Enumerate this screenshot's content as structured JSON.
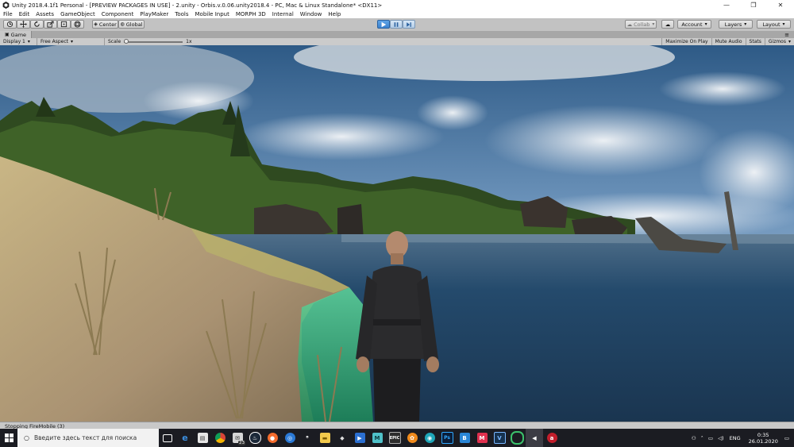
{
  "window": {
    "title": "Unity 2018.4.1f1 Personal - [PREVIEW PACKAGES IN USE] - 2.unity - Orbis.v.0.06.unity2018.4 - PC, Mac & Linux Standalone* <DX11>",
    "minimize": "—",
    "maximize": "❐",
    "close": "✕"
  },
  "menu": [
    "File",
    "Edit",
    "Assets",
    "GameObject",
    "Component",
    "PlayMaker",
    "Tools",
    "Mobile Input",
    "MORPH 3D",
    "Internal",
    "Window",
    "Help"
  ],
  "toolbar": {
    "pivot_label": "Center",
    "space_label": "Global",
    "collab_label": "Collab",
    "account_label": "Account",
    "layers_label": "Layers",
    "layout_label": "Layout"
  },
  "game_tab": {
    "label": "Game"
  },
  "game_bar": {
    "display": "Display 1",
    "aspect": "Free Aspect",
    "scale_label": "Scale",
    "scale_value": "1x",
    "scale_level": 0.0,
    "maximize_on_play": "Maximize On Play",
    "mute_audio": "Mute Audio",
    "stats": "Stats",
    "gizmos": "Gizmos"
  },
  "status": {
    "message": "Stopping FireMobile (3)"
  },
  "taskbar": {
    "search_placeholder": "Введите здесь текст для поиска",
    "badge_count": "23",
    "language": "ENG",
    "time": "0:35",
    "date": "26.01.2020"
  },
  "colors": {
    "unity_chrome": "#c2c2c2",
    "play_active": "#3b82cf",
    "taskbar": "#1b1c22",
    "sky_top": "#2f5e8e",
    "water": "#1e3f5e"
  }
}
